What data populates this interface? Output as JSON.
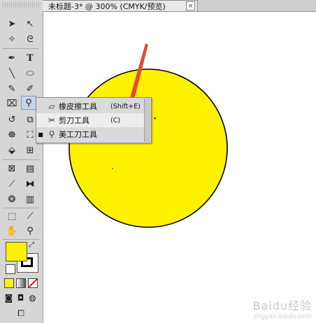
{
  "document": {
    "title": "未标题-3* @ 300% (CMYK/预览)",
    "close_glyph": "×"
  },
  "canvas": {
    "circle_fill": "#fff200",
    "circle_stroke": "#000000",
    "arrow_color": "#e8473c"
  },
  "toolbar": {
    "fill_color": "#fff200",
    "stroke_color": "#000000"
  },
  "flyout": {
    "items": [
      {
        "label": "橡皮擦工具",
        "shortcut": "(Shift+E)",
        "icon": "eraser-icon",
        "icon_glyph": "▱",
        "checked": false
      },
      {
        "label": "剪刀工具",
        "shortcut": "(C)",
        "icon": "scissors-icon",
        "icon_glyph": "✂",
        "checked": false
      },
      {
        "label": "美工刀工具",
        "shortcut": "",
        "icon": "knife-icon",
        "icon_glyph": "⚲",
        "checked": true
      }
    ]
  },
  "watermark": {
    "text": "Baidu经验",
    "subtext": "jingyan.baidu.com"
  }
}
